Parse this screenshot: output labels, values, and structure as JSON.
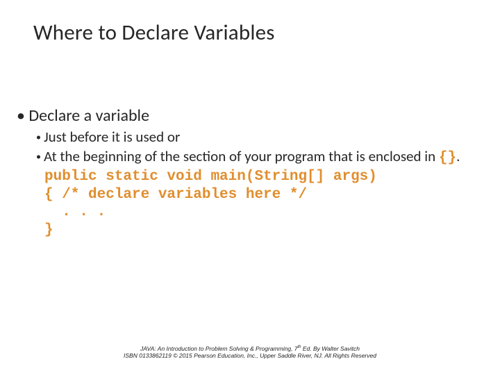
{
  "title": "Where to Declare Variables",
  "body": {
    "l1": "Declare a variable",
    "l2a": "Just before it is used or",
    "l2b_pre": "At the beginning of the section of your program that is enclosed in ",
    "l2b_braces": "{}",
    "l2b_post": "."
  },
  "code": {
    "line1": "public static void main(String[] args)",
    "line2": "{ /* declare variables here */",
    "line3": "  . . .",
    "line4": "}"
  },
  "footer": {
    "line1_a": "JAVA: An Introduction to Problem Solving & Programming, 7",
    "line1_sup": "th",
    "line1_b": " Ed. By Walter Savitch",
    "line2": "ISBN 0133862119 © 2015 Pearson Education, Inc., Upper Saddle River, NJ. All Rights Reserved"
  }
}
